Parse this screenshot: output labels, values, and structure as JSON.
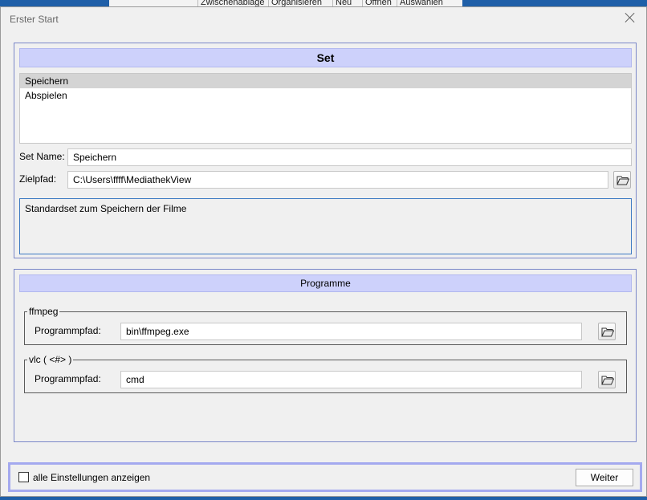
{
  "background": {
    "ribbon_items": [
      "Zwischenablage",
      "Organisieren",
      "Neu",
      "Öffnen",
      "Auswählen"
    ]
  },
  "dialog": {
    "title": "Erster Start",
    "close_icon": "close-icon"
  },
  "set_panel": {
    "header": "Set",
    "list_items": [
      "Speichern",
      "Abspielen"
    ],
    "selected_item": "Speichern",
    "set_name_label": "Set Name:",
    "set_name_value": "Speichern",
    "zielpfad_label": "Zielpfad:",
    "zielpfad_value": "C:\\Users\\ffff\\MediathekView",
    "description": "Standardset zum Speichern der Filme"
  },
  "programme_panel": {
    "header": "Programme",
    "groups": [
      {
        "title": "ffmpeg",
        "path_label": "Programmpfad:",
        "path_value": "bin\\ffmpeg.exe"
      },
      {
        "title": "vlc ( <#> )",
        "path_label": "Programmpfad:",
        "path_value": "cmd"
      }
    ]
  },
  "footer": {
    "checkbox_label": "alle Einstellungen anzeigen",
    "checkbox_checked": false,
    "next_button": "Weiter"
  },
  "colors": {
    "panel_header_bg": "#cdd1fb",
    "panel_border": "#7a87c8",
    "footer_border": "#a4a9ef",
    "selection_bg": "#d4d4d4"
  }
}
